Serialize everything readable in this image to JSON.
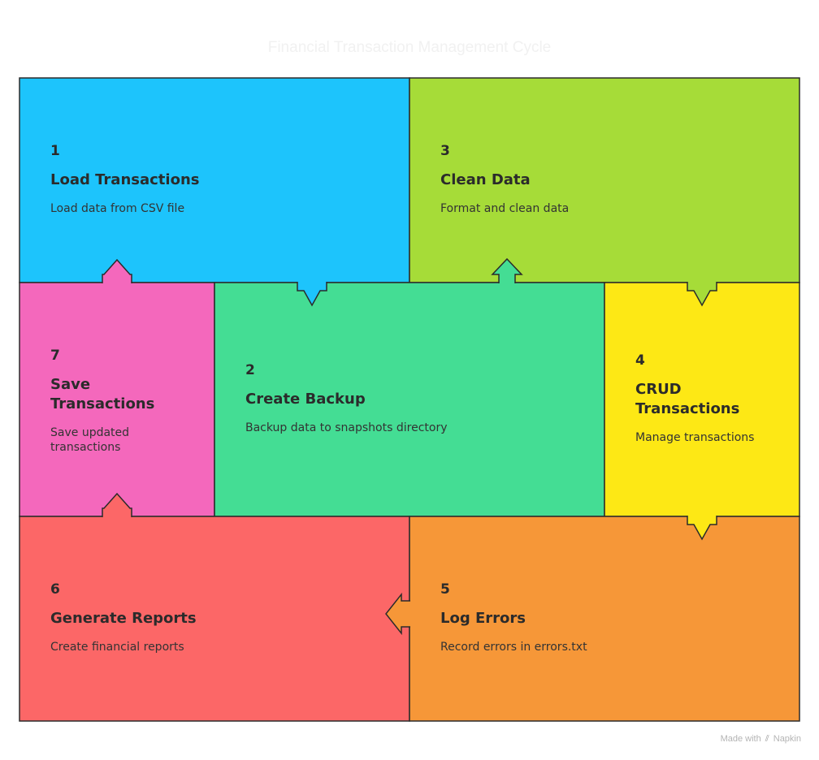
{
  "title": "Financial Transaction Management Cycle",
  "steps": [
    {
      "id": "step1",
      "number": "1",
      "title": "Load Transactions",
      "description": "Load data from CSV file",
      "color": "#1dc4fc"
    },
    {
      "id": "step2",
      "number": "2",
      "title": "Create Backup",
      "description": "Backup data to snapshots directory",
      "color": "#44dd94"
    },
    {
      "id": "step3",
      "number": "3",
      "title": "Clean Data",
      "description": "Format and clean data",
      "color": "#a6dc38"
    },
    {
      "id": "step4",
      "number": "4",
      "title": "CRUD Transactions",
      "description": "Manage transactions",
      "color": "#fde815"
    },
    {
      "id": "step5",
      "number": "5",
      "title": "Log Errors",
      "description": "Record errors in errors.txt",
      "color": "#f69738"
    },
    {
      "id": "step6",
      "number": "6",
      "title": "Generate Reports",
      "description": "Create financial reports",
      "color": "#fc6767"
    },
    {
      "id": "step7",
      "number": "7",
      "title": "Save Transactions",
      "description": "Save updated transactions",
      "color": "#f468bc"
    }
  ],
  "flow": [
    {
      "from": "1",
      "to": "2"
    },
    {
      "from": "2",
      "to": "3"
    },
    {
      "from": "3",
      "to": "4"
    },
    {
      "from": "4",
      "to": "5"
    },
    {
      "from": "5",
      "to": "6"
    },
    {
      "from": "6",
      "to": "7"
    },
    {
      "from": "7",
      "to": "1"
    }
  ],
  "footer": {
    "made_with": "Made with",
    "brand": "Napkin",
    "icon": "napkin-logo-icon"
  }
}
